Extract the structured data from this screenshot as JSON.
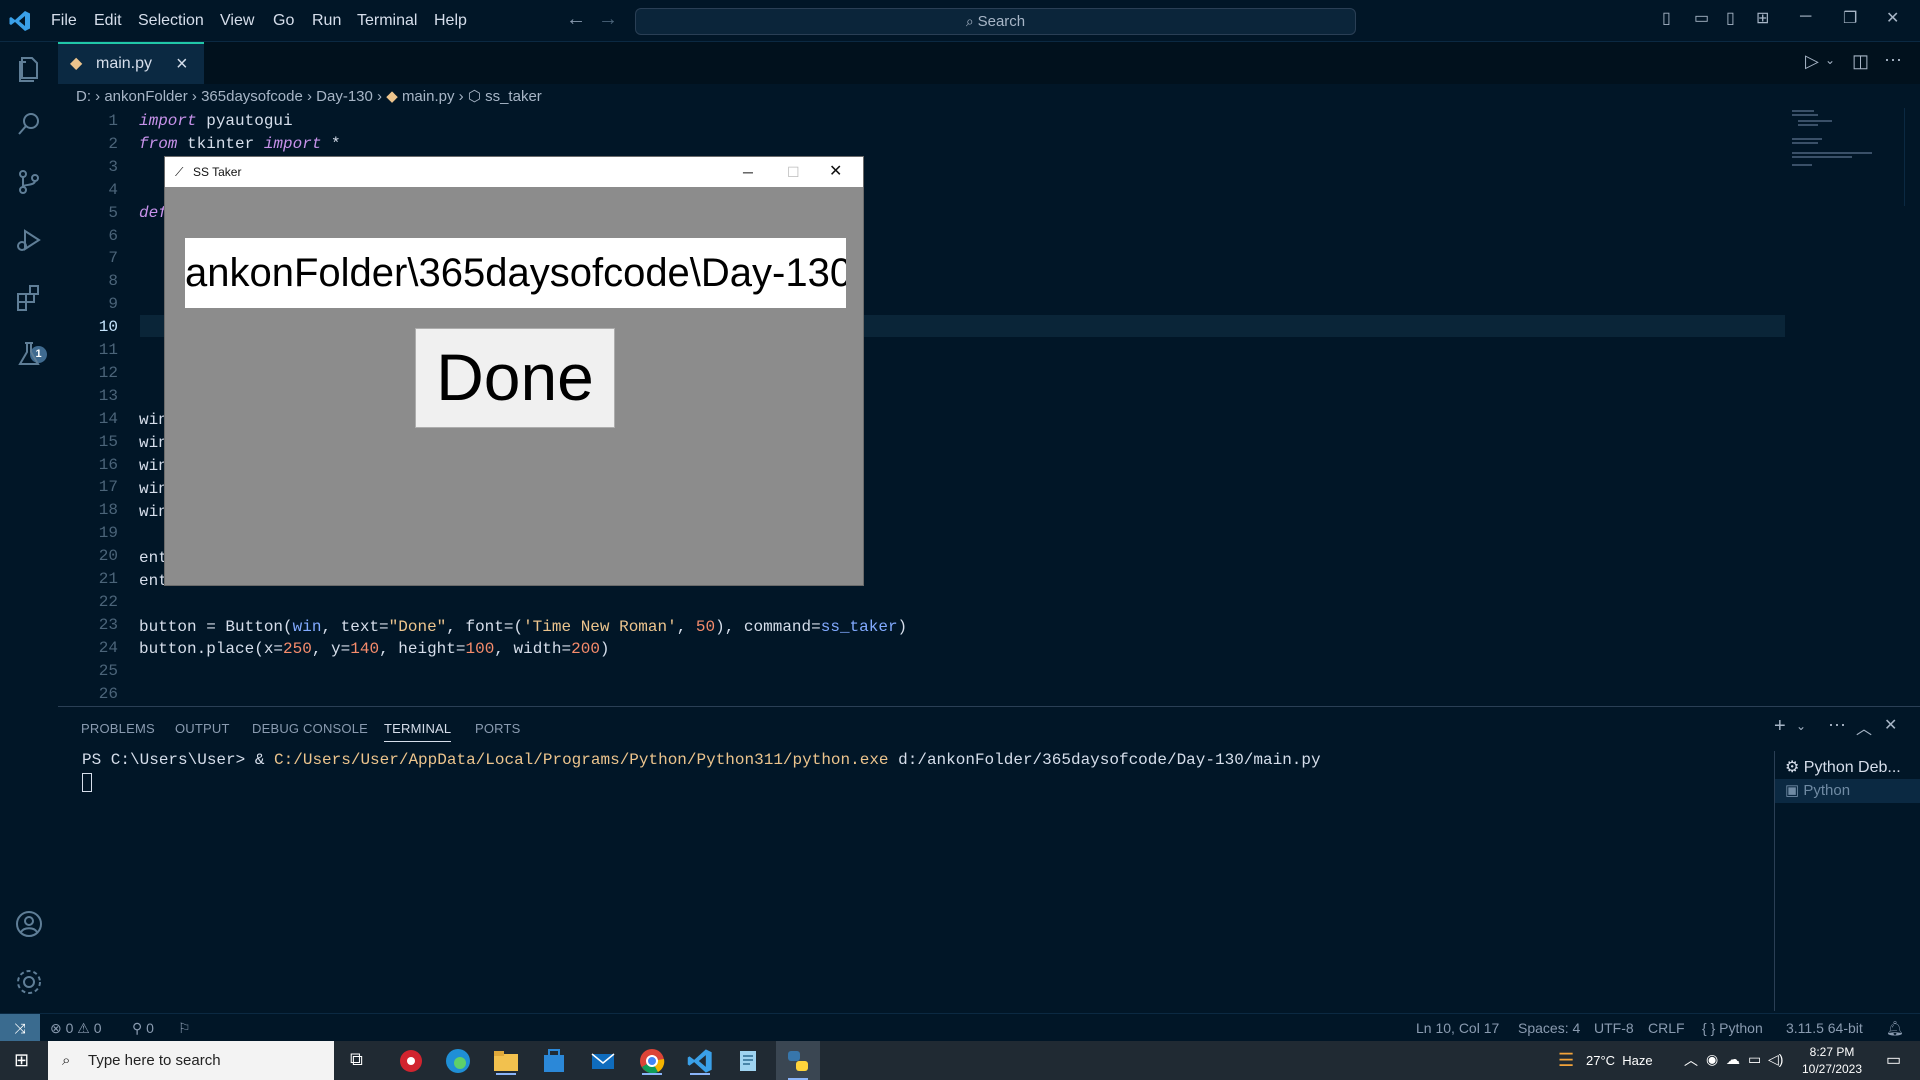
{
  "menu": [
    "File",
    "Edit",
    "Selection",
    "View",
    "Go",
    "Run",
    "Terminal",
    "Help"
  ],
  "search": {
    "label": "Search"
  },
  "tab": {
    "label": "main.py",
    "close": "×"
  },
  "breadcrumb": [
    "D:",
    "ankonFolder",
    "365daysofcode",
    "Day-130",
    "main.py",
    "ss_taker"
  ],
  "activity_badge": "1",
  "editor": {
    "line_numbers": [
      "1",
      "2",
      "3",
      "4",
      "5",
      "6",
      "7",
      "8",
      "9",
      "10",
      "11",
      "12",
      "13",
      "14",
      "15",
      "16",
      "17",
      "18",
      "19",
      "20",
      "21",
      "22",
      "23",
      "24",
      "25",
      "26"
    ],
    "current_line": "10",
    "lines": {
      "l1_kw": "import",
      "l1_rest": " pyautogui",
      "l2_kw1": "from",
      "l2_mid": " tkinter ",
      "l2_kw2": "import",
      "l2_rest": " *",
      "l5": "def",
      "l14": "win",
      "l15": "win",
      "l16": "win",
      "l17": "win",
      "l18": "win",
      "l20": "ent",
      "l21": "ent",
      "l23": {
        "a": "button = Button(",
        "b": "win",
        "c": ", text=",
        "d": "\"Done\"",
        "e": ", font=(",
        "f": "'Time New Roman'",
        "g": ", ",
        "h": "50",
        "i": "), command=",
        "j": "ss_taker",
        "k": ")"
      },
      "l24": {
        "a": "button.place(x=",
        "b": "250",
        "c": ", y=",
        "d": "140",
        "e": ", height=",
        "f": "100",
        "g": ", width=",
        "h": "200",
        "i": ")"
      }
    }
  },
  "tk_window": {
    "title": "SS Taker",
    "entry_value": "ankonFolder\\365daysofcode\\Day-130",
    "button_label": "Done"
  },
  "panel": {
    "tabs": [
      "PROBLEMS",
      "OUTPUT",
      "DEBUG CONSOLE",
      "TERMINAL",
      "PORTS"
    ],
    "active_tab": "TERMINAL",
    "terminal": {
      "prompt": "PS C:\\Users\\User> & ",
      "exe": "C:/Users/User/AppData/Local/Programs/Python/Python311/python.exe",
      "arg": " d:/ankonFolder/365daysofcode/Day-130/main.py"
    },
    "terminal_list": [
      "Python Deb...",
      "Python"
    ]
  },
  "status": {
    "errors": "0",
    "warnings": "0",
    "ports": "0",
    "position": "Ln 10, Col 17",
    "spaces": "Spaces: 4",
    "encoding": "UTF-8",
    "eol": "CRLF",
    "language": "Python",
    "interpreter": "3.11.5 64-bit"
  },
  "taskbar": {
    "search_placeholder": "Type here to search",
    "weather": "27°C  Haze",
    "time": "8:27 PM",
    "date": "10/27/2023"
  },
  "colors": {
    "accent": "#21c7a8",
    "keyword": "#c792ea",
    "string": "#ecc48d",
    "number": "#f78c6c"
  }
}
